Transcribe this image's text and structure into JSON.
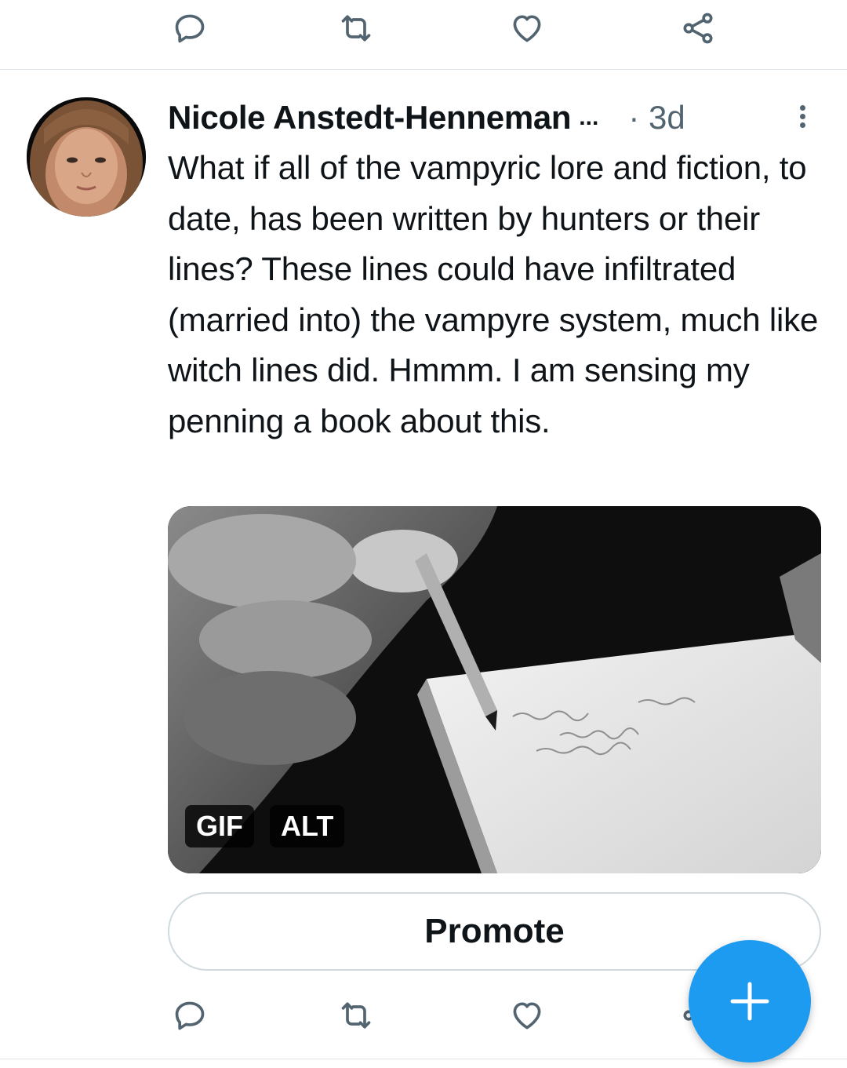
{
  "tweet": {
    "author_name": "Nicole Anstedt-Henneman",
    "name_ellipsis": "...",
    "timestamp": "· 3d",
    "text": "What if all of the vampyric lore and fiction, to date, has been written by hunters or their lines? These lines could have infiltrated (married into) the vampyre system, much like witch lines did. Hmmm. I am sensing my penning a book about this.",
    "media": {
      "badges": {
        "gif": "GIF",
        "alt": "ALT"
      }
    },
    "promote_label": "Promote"
  },
  "actions": [
    "reply-icon",
    "retweet-icon",
    "like-icon",
    "share-icon"
  ],
  "fab": {
    "icon": "plus-icon"
  },
  "colors": {
    "icon": "#536471",
    "accent": "#1d9bf0",
    "divider": "#dfe4e8"
  }
}
